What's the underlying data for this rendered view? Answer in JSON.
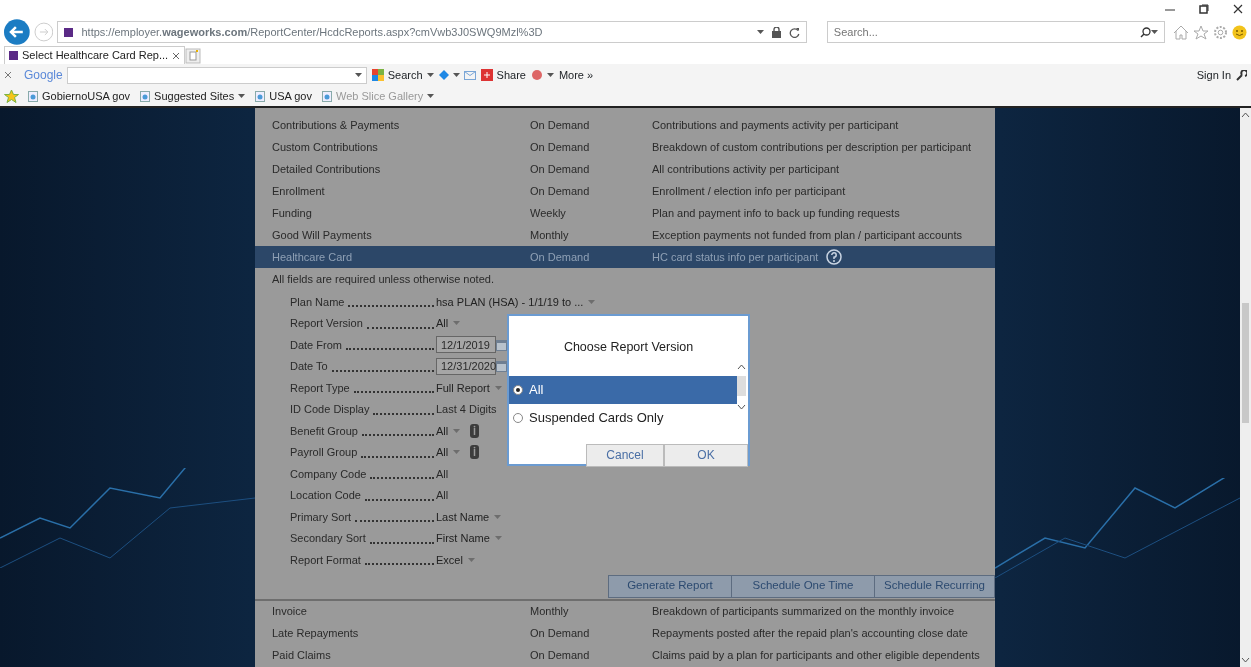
{
  "browser": {
    "url": "https://employer.**wageworks.com**/ReportCenter/HcdcReports.aspx?cmVwb3J0SWQ9Mzl%3D",
    "search_placeholder": "Search...",
    "tab": {
      "title": "Select Healthcare Card Rep..."
    },
    "toolbar": {
      "brand": "Google",
      "items": [
        {
          "label": "Search",
          "dropdown": true
        },
        {
          "label": "Share",
          "dropdown": false
        },
        {
          "label": "More »",
          "dropdown": false
        }
      ],
      "sign_in": "Sign In"
    },
    "favorites": [
      {
        "label": "GobiernoUSA gov",
        "dropdown": false,
        "disabled": false
      },
      {
        "label": "Suggested Sites",
        "dropdown": true,
        "disabled": false
      },
      {
        "label": "USA gov",
        "dropdown": false,
        "disabled": false
      },
      {
        "label": "Web Slice Gallery",
        "dropdown": true,
        "disabled": true
      }
    ]
  },
  "reports_top": [
    {
      "name": "Contributions & Payments",
      "frequency": "On Demand",
      "description": "Contributions and payments activity per participant",
      "selected": false,
      "help": false
    },
    {
      "name": "Custom Contributions",
      "frequency": "On Demand",
      "description": "Breakdown of custom contributions per description per participant",
      "selected": false,
      "help": false
    },
    {
      "name": "Detailed Contributions",
      "frequency": "On Demand",
      "description": "All contributions activity per participant",
      "selected": false,
      "help": false
    },
    {
      "name": "Enrollment",
      "frequency": "On Demand",
      "description": "Enrollment / election info per participant",
      "selected": false,
      "help": false
    },
    {
      "name": "Funding",
      "frequency": "Weekly",
      "description": "Plan and payment info to back up funding requests",
      "selected": false,
      "help": false
    },
    {
      "name": "Good Will Payments",
      "frequency": "Monthly",
      "description": "Exception payments not funded from plan / participant accounts",
      "selected": false,
      "help": false
    },
    {
      "name": "Healthcare Card",
      "frequency": "On Demand",
      "description": "HC card status info per participant",
      "selected": true,
      "help": true
    }
  ],
  "form": {
    "note": "All fields are required unless otherwise noted.",
    "fields": [
      {
        "label": "Plan Name",
        "value": "hsa PLAN (HSA) - 1/1/19 to ...",
        "kind": "select",
        "info": false
      },
      {
        "label": "Report Version",
        "value": "All",
        "kind": "select",
        "info": false
      },
      {
        "label": "Date From",
        "value": "12/1/2019",
        "kind": "date",
        "info": false
      },
      {
        "label": "Date To",
        "value": "12/31/2020",
        "kind": "date",
        "info": false
      },
      {
        "label": "Report Type",
        "value": "Full Report",
        "kind": "select",
        "info": false
      },
      {
        "label": "ID Code Display",
        "value": "Last 4 Digits",
        "kind": "text",
        "info": false
      },
      {
        "label": "Benefit Group",
        "value": "All",
        "kind": "select",
        "info": true
      },
      {
        "label": "Payroll Group",
        "value": "All",
        "kind": "select",
        "info": true
      },
      {
        "label": "Company Code",
        "value": "All",
        "kind": "text",
        "info": false
      },
      {
        "label": "Location Code",
        "value": "All",
        "kind": "text",
        "info": false
      },
      {
        "label": "Primary Sort",
        "value": "Last Name",
        "kind": "select",
        "info": false
      },
      {
        "label": "Secondary Sort",
        "value": "First Name",
        "kind": "select",
        "info": false
      },
      {
        "label": "Report Format",
        "value": "Excel",
        "kind": "select",
        "info": false
      }
    ],
    "buttons": [
      "Generate Report",
      "Schedule One Time",
      "Schedule Recurring"
    ]
  },
  "reports_bottom": [
    {
      "name": "Invoice",
      "frequency": "Monthly",
      "description": "Breakdown of participants summarized on the monthly invoice",
      "selected": false,
      "help": false
    },
    {
      "name": "Late Repayments",
      "frequency": "On Demand",
      "description": "Repayments posted after the repaid plan's accounting close date",
      "selected": false,
      "help": false
    },
    {
      "name": "Paid Claims",
      "frequency": "On Demand",
      "description": "Claims paid by a plan for participants and other eligible dependents",
      "selected": false,
      "help": false
    }
  ],
  "dialog": {
    "title": "Choose Report Version",
    "options": [
      {
        "label": "All",
        "selected": true
      },
      {
        "label": "Suspended Cards Only",
        "selected": false
      }
    ],
    "buttons": [
      "Cancel",
      "OK"
    ]
  }
}
